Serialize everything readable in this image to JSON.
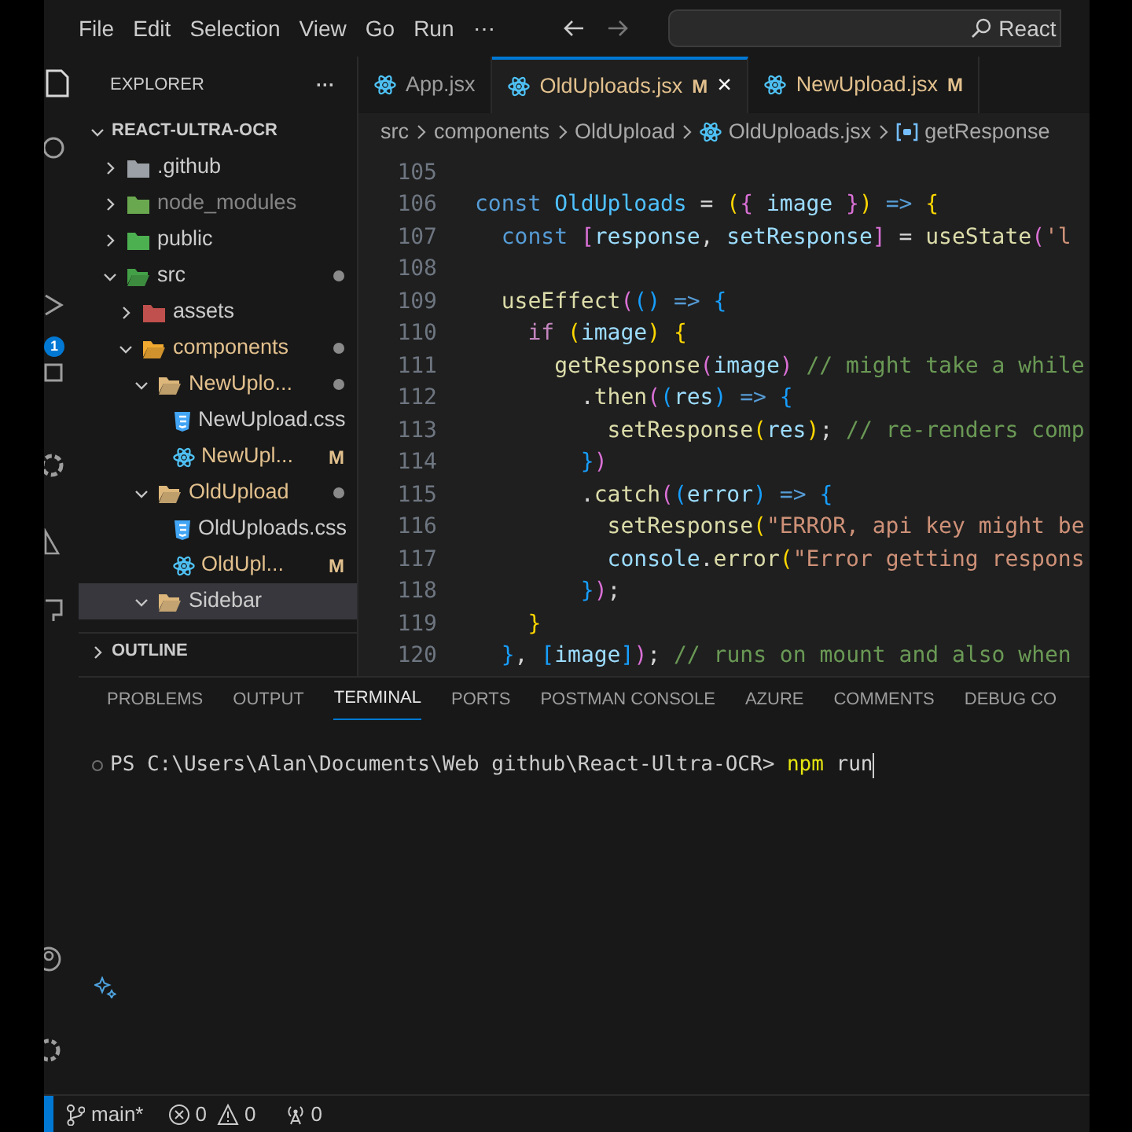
{
  "menu": [
    "File",
    "Edit",
    "Selection",
    "View",
    "Go",
    "Run",
    "⋯"
  ],
  "command_center": {
    "value": "React"
  },
  "activity_bar": {
    "badge": "1"
  },
  "explorer": {
    "title": "EXPLORER",
    "more": "···",
    "root": "REACT-ULTRA-OCR",
    "items": [
      {
        "name": ".github",
        "kind": "folder",
        "color": "#9aa0a6",
        "expanded": false,
        "changed": false,
        "dot": false,
        "dimmed": false,
        "selected": false
      },
      {
        "name": "node_modules",
        "kind": "folder",
        "color": "#6aa84f",
        "expanded": false,
        "changed": false,
        "dot": false,
        "dimmed": true,
        "selected": false
      },
      {
        "name": "public",
        "kind": "folder",
        "color": "#4caf50",
        "expanded": false,
        "changed": false,
        "dot": false,
        "dimmed": false,
        "selected": false
      },
      {
        "name": "src",
        "kind": "folder",
        "color": "#43a047",
        "expanded": true,
        "changed": false,
        "dot": true,
        "dimmed": false,
        "selected": false,
        "children": [
          {
            "name": "assets",
            "kind": "folder",
            "color": "#c0504d",
            "expanded": false,
            "changed": false,
            "dot": false,
            "dimmed": false,
            "selected": false
          },
          {
            "name": "components",
            "kind": "folder",
            "color": "#f0a830",
            "expanded": true,
            "changed": true,
            "dot": true,
            "dimmed": false,
            "selected": false,
            "children": [
              {
                "name": "NewUplo...",
                "kind": "folder",
                "color": "#dcb67a",
                "expanded": true,
                "changed": true,
                "dot": true,
                "dimmed": false,
                "selected": false,
                "children": [
                  {
                    "name": "NewUpload.css",
                    "kind": "css",
                    "changed": false,
                    "dot": false,
                    "dimmed": false,
                    "selected": false
                  },
                  {
                    "name": "NewUpl...",
                    "kind": "jsx",
                    "changed": true,
                    "status": "M",
                    "dot": false,
                    "dimmed": false,
                    "selected": false
                  }
                ]
              },
              {
                "name": "OldUpload",
                "kind": "folder",
                "color": "#dcb67a",
                "expanded": true,
                "changed": true,
                "dot": true,
                "dimmed": false,
                "selected": false,
                "children": [
                  {
                    "name": "OldUploads.css",
                    "kind": "css",
                    "changed": false,
                    "dot": false,
                    "dimmed": false,
                    "selected": false
                  },
                  {
                    "name": "OldUpl...",
                    "kind": "jsx",
                    "changed": true,
                    "status": "M",
                    "dot": false,
                    "dimmed": false,
                    "selected": false
                  }
                ]
              },
              {
                "name": "Sidebar",
                "kind": "folder",
                "color": "#dcb67a",
                "expanded": true,
                "changed": false,
                "dot": false,
                "dimmed": false,
                "selected": true
              }
            ]
          }
        ]
      }
    ],
    "outline": "OUTLINE"
  },
  "tabs": [
    {
      "label": "App.jsx",
      "changed": false,
      "selected": false
    },
    {
      "label": "OldUploads.jsx",
      "status": "M",
      "changed": true,
      "selected": true,
      "close": "×"
    },
    {
      "label": "NewUpload.jsx",
      "status": "M",
      "changed": true,
      "selected": false
    }
  ],
  "breadcrumb": [
    {
      "label": "src",
      "kind": "folder"
    },
    {
      "label": "components",
      "kind": "folder"
    },
    {
      "label": "OldUpload",
      "kind": "folder"
    },
    {
      "label": "OldUploads.jsx",
      "kind": "jsx"
    },
    {
      "label": "getResponse",
      "kind": "symbol"
    }
  ],
  "code": [
    {
      "n": "105"
    },
    {
      "n": "106",
      "tokens": [
        {
          "kind": "kw",
          "text": "const "
        },
        {
          "kind": "const",
          "text": "OldUploads"
        },
        {
          "kind": "p",
          "text": " = "
        },
        {
          "kind": "b1",
          "text": "("
        },
        {
          "kind": "b2",
          "text": "{ "
        },
        {
          "kind": "var",
          "text": "image"
        },
        {
          "kind": "b2",
          "text": " }"
        },
        {
          "kind": "b1",
          "text": ")"
        },
        {
          "kind": "kw",
          "text": " =>"
        },
        {
          "kind": "b1",
          "text": " {"
        }
      ]
    },
    {
      "n": "107",
      "tokens": [
        {
          "kind": "kw",
          "text": "  const "
        },
        {
          "kind": "b2",
          "text": "["
        },
        {
          "kind": "var",
          "text": "response"
        },
        {
          "kind": "p",
          "text": ", "
        },
        {
          "kind": "var",
          "text": "setResponse"
        },
        {
          "kind": "b2",
          "text": "]"
        },
        {
          "kind": "p",
          "text": " = "
        },
        {
          "kind": "fn",
          "text": "useState"
        },
        {
          "kind": "b2",
          "text": "("
        },
        {
          "kind": "str",
          "text": "'l"
        }
      ]
    },
    {
      "n": "108"
    },
    {
      "n": "109",
      "tokens": [
        {
          "kind": "fn",
          "text": "  useEffect"
        },
        {
          "kind": "b2",
          "text": "("
        },
        {
          "kind": "b3",
          "text": "()"
        },
        {
          "kind": "kw",
          "text": " =>"
        },
        {
          "kind": "b3",
          "text": " {"
        }
      ]
    },
    {
      "n": "110",
      "tokens": [
        {
          "kind": "ctrl",
          "text": "    if "
        },
        {
          "kind": "b1",
          "text": "("
        },
        {
          "kind": "var",
          "text": "image"
        },
        {
          "kind": "b1",
          "text": ")"
        },
        {
          "kind": "b1",
          "text": " {"
        }
      ]
    },
    {
      "n": "111",
      "tokens": [
        {
          "kind": "fn",
          "text": "      getResponse"
        },
        {
          "kind": "b2",
          "text": "("
        },
        {
          "kind": "var",
          "text": "image"
        },
        {
          "kind": "b2",
          "text": ")"
        },
        {
          "kind": "com",
          "text": " // might take a while"
        }
      ]
    },
    {
      "n": "112",
      "tokens": [
        {
          "kind": "p",
          "text": "        ."
        },
        {
          "kind": "fn",
          "text": "then"
        },
        {
          "kind": "b2",
          "text": "("
        },
        {
          "kind": "b3",
          "text": "("
        },
        {
          "kind": "var",
          "text": "res"
        },
        {
          "kind": "b3",
          "text": ")"
        },
        {
          "kind": "kw",
          "text": " =>"
        },
        {
          "kind": "b3",
          "text": " {"
        }
      ]
    },
    {
      "n": "113",
      "tokens": [
        {
          "kind": "fn",
          "text": "          setResponse"
        },
        {
          "kind": "b1",
          "text": "("
        },
        {
          "kind": "var",
          "text": "res"
        },
        {
          "kind": "b1",
          "text": ")"
        },
        {
          "kind": "p",
          "text": ";"
        },
        {
          "kind": "com",
          "text": " // re-renders comp"
        }
      ]
    },
    {
      "n": "114",
      "tokens": [
        {
          "kind": "b3",
          "text": "        }"
        },
        {
          "kind": "b2",
          "text": ")"
        }
      ]
    },
    {
      "n": "115",
      "tokens": [
        {
          "kind": "p",
          "text": "        ."
        },
        {
          "kind": "fn",
          "text": "catch"
        },
        {
          "kind": "b2",
          "text": "("
        },
        {
          "kind": "b3",
          "text": "("
        },
        {
          "kind": "var",
          "text": "error"
        },
        {
          "kind": "b3",
          "text": ")"
        },
        {
          "kind": "kw",
          "text": " =>"
        },
        {
          "kind": "b3",
          "text": " {"
        }
      ]
    },
    {
      "n": "116",
      "tokens": [
        {
          "kind": "fn",
          "text": "          setResponse"
        },
        {
          "kind": "b1",
          "text": "("
        },
        {
          "kind": "str",
          "text": "\"ERROR, api key might be"
        }
      ]
    },
    {
      "n": "117",
      "tokens": [
        {
          "kind": "var",
          "text": "          console"
        },
        {
          "kind": "p",
          "text": "."
        },
        {
          "kind": "fn",
          "text": "error"
        },
        {
          "kind": "b1",
          "text": "("
        },
        {
          "kind": "str",
          "text": "\"Error getting respons"
        }
      ]
    },
    {
      "n": "118",
      "tokens": [
        {
          "kind": "b3",
          "text": "        }"
        },
        {
          "kind": "b2",
          "text": ")"
        },
        {
          "kind": "p",
          "text": ";"
        }
      ]
    },
    {
      "n": "119",
      "tokens": [
        {
          "kind": "b1",
          "text": "    }"
        }
      ]
    },
    {
      "n": "120",
      "tokens": [
        {
          "kind": "b3",
          "text": "  }"
        },
        {
          "kind": "p",
          "text": ", "
        },
        {
          "kind": "b3",
          "text": "["
        },
        {
          "kind": "var",
          "text": "image"
        },
        {
          "kind": "b3",
          "text": "]"
        },
        {
          "kind": "b2",
          "text": ")"
        },
        {
          "kind": "p",
          "text": ";"
        },
        {
          "kind": "com",
          "text": " // runs on mount and also when"
        }
      ]
    }
  ],
  "panel_tabs": [
    {
      "label": "PROBLEMS",
      "selected": false
    },
    {
      "label": "OUTPUT",
      "selected": false
    },
    {
      "label": "TERMINAL",
      "selected": true
    },
    {
      "label": "PORTS",
      "selected": false
    },
    {
      "label": "POSTMAN CONSOLE",
      "selected": false
    },
    {
      "label": "AZURE",
      "selected": false
    },
    {
      "label": "COMMENTS",
      "selected": false
    },
    {
      "label": "DEBUG CO",
      "selected": false
    }
  ],
  "terminal": {
    "prompt": "PS C:\\Users\\Alan\\Documents\\Web github\\React-Ultra-OCR>",
    "command": [
      {
        "kind": "cmd",
        "text": "npm"
      },
      {
        "kind": "p",
        "text": " run"
      }
    ]
  },
  "status_bar": {
    "branch": "main*",
    "errors": "0",
    "warnings": "0",
    "ports": "0"
  }
}
